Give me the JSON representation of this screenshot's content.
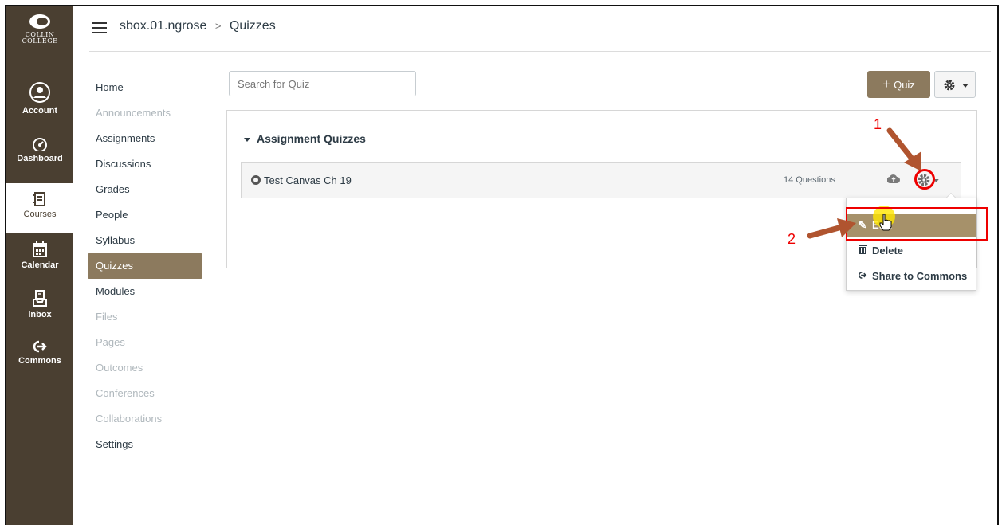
{
  "logo": {
    "line1": "COLLIN",
    "line2": "COLLEGE"
  },
  "global_nav": [
    {
      "label": "Account",
      "icon": "account-icon"
    },
    {
      "label": "Dashboard",
      "icon": "dashboard-icon"
    },
    {
      "label": "Courses",
      "icon": "courses-icon"
    },
    {
      "label": "Calendar",
      "icon": "calendar-icon"
    },
    {
      "label": "Inbox",
      "icon": "inbox-icon"
    },
    {
      "label": "Commons",
      "icon": "commons-icon"
    }
  ],
  "breadcrumb": {
    "course": "sbox.01.ngrose",
    "separator": ">",
    "page": "Quizzes"
  },
  "course_nav": [
    {
      "label": "Home",
      "state": "enabled"
    },
    {
      "label": "Announcements",
      "state": "disabled"
    },
    {
      "label": "Assignments",
      "state": "enabled"
    },
    {
      "label": "Discussions",
      "state": "enabled"
    },
    {
      "label": "Grades",
      "state": "enabled"
    },
    {
      "label": "People",
      "state": "enabled"
    },
    {
      "label": "Syllabus",
      "state": "enabled"
    },
    {
      "label": "Quizzes",
      "state": "active"
    },
    {
      "label": "Modules",
      "state": "enabled"
    },
    {
      "label": "Files",
      "state": "disabled"
    },
    {
      "label": "Pages",
      "state": "disabled"
    },
    {
      "label": "Outcomes",
      "state": "disabled"
    },
    {
      "label": "Conferences",
      "state": "disabled"
    },
    {
      "label": "Collaborations",
      "state": "disabled"
    },
    {
      "label": "Settings",
      "state": "enabled"
    }
  ],
  "toolbar": {
    "search_placeholder": "Search for Quiz",
    "add_quiz_label": "Quiz",
    "add_quiz_plus": "+"
  },
  "quiz_group": {
    "title": "Assignment Quizzes"
  },
  "quiz": {
    "name": "Test Canvas Ch 19",
    "questions": "14 Questions"
  },
  "menu": {
    "edit": "Edit",
    "delete": "Delete",
    "share": "Share to Commons"
  },
  "annotations": {
    "step1": "1",
    "step2": "2"
  },
  "colors": {
    "nav_bg": "#4a3f31",
    "accent": "#8c7a5e",
    "highlight_red": "#e00000"
  }
}
